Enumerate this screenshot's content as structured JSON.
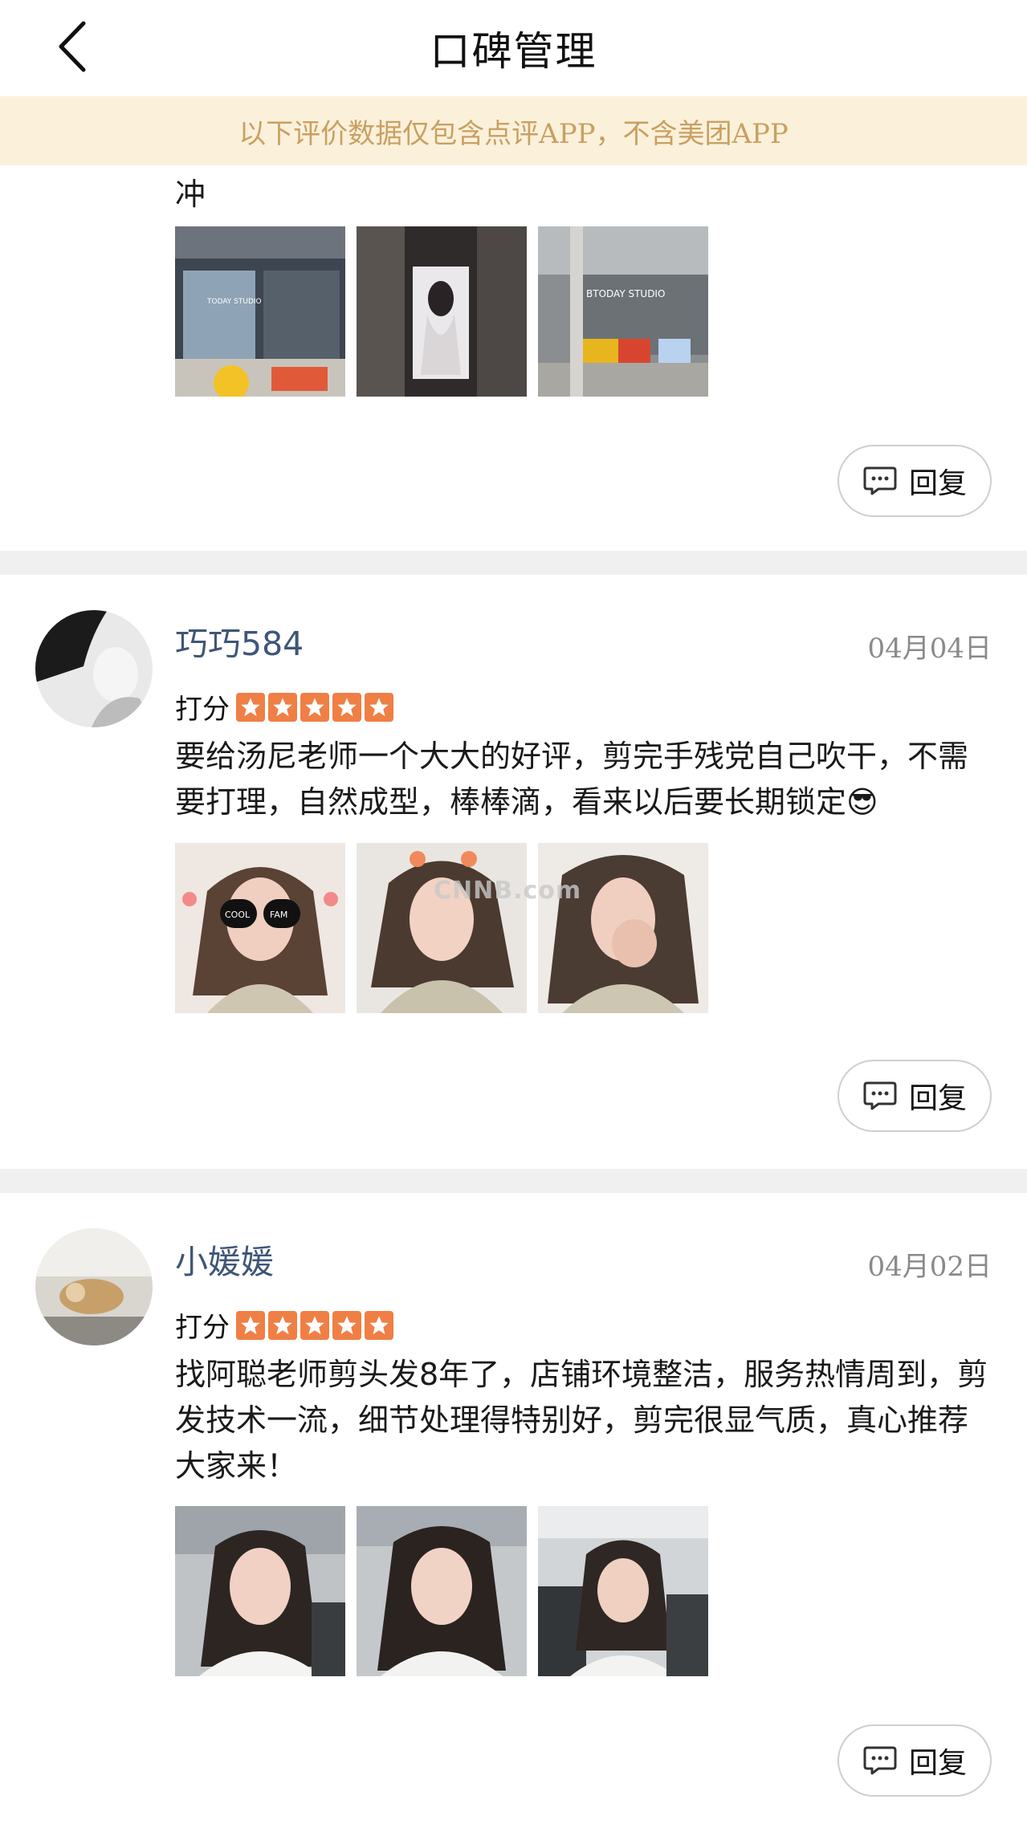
{
  "header": {
    "title": "口碑管理",
    "back_icon": "chevron-left-icon"
  },
  "notice": {
    "text": "以下评价数据仅包含点评APP，不含美团APP"
  },
  "reviews": [
    {
      "text": "冲",
      "photos": [
        "storefront-photo-1",
        "storefront-photo-2",
        "storefront-photo-3"
      ],
      "photo_texts": [
        "TODAY STUDIO",
        "BTODAY STUDIO"
      ],
      "reply_label": "回复"
    },
    {
      "username": "巧巧584",
      "date": "04月04日",
      "rating_label": "打分",
      "stars": 5,
      "text": "要给汤尼老师一个大大的好评，剪完手残党自己吹干，不需要打理，自然成型，棒棒滴，看来以后要长期锁定😎",
      "photos": [
        "selfie-photo-1",
        "selfie-photo-2",
        "selfie-photo-3"
      ],
      "photo_texts": [
        "COOL",
        "FAM"
      ],
      "reply_label": "回复"
    },
    {
      "username": "小媛媛",
      "date": "04月02日",
      "rating_label": "打分",
      "stars": 5,
      "text": "找阿聪老师剪头发8年了，店铺环境整洁，服务热情周到，剪发技术一流，细节处理得特别好，剪完很显气质，真心推荐大家来！",
      "photos": [
        "car-selfie-1",
        "car-selfie-2",
        "car-selfie-3"
      ],
      "reply_label": "回复"
    }
  ],
  "watermark": "CNNB.com",
  "colors": {
    "notice_bg": "#fbf1db",
    "notice_text": "#c9a061",
    "username": "#3e5677",
    "star": "#ef7f45",
    "separator": "#f0f0f0"
  }
}
